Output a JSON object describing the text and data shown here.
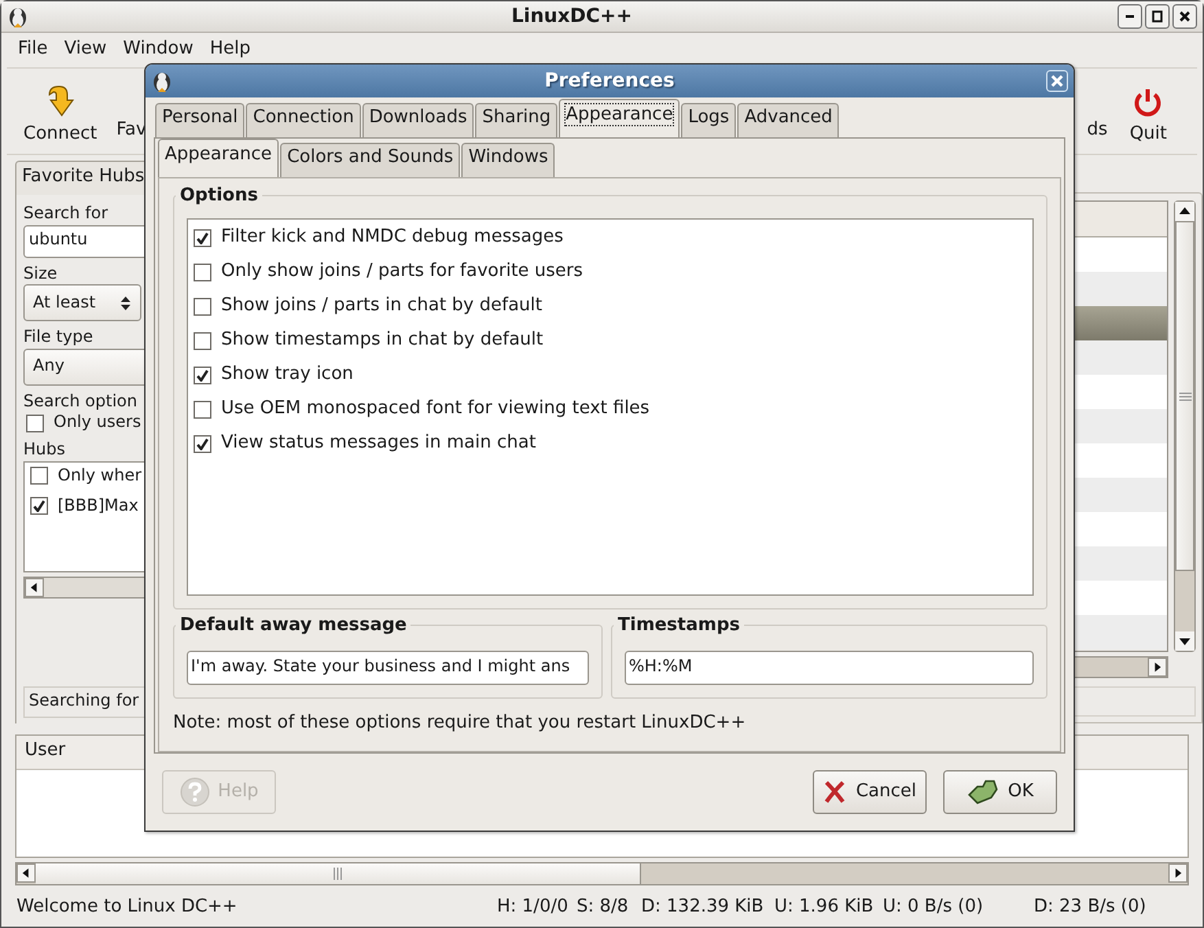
{
  "window": {
    "title": "LinuxDC++"
  },
  "menu": [
    "File",
    "View",
    "Window",
    "Help"
  ],
  "toolbar": [
    {
      "label": "Connect",
      "kind": "connect"
    },
    {
      "label": "Fav",
      "kind": "partial"
    },
    {
      "label": "ds",
      "kind": "partial"
    },
    {
      "label": "Quit",
      "kind": "quit"
    }
  ],
  "search_panel": {
    "tab": "Favorite Hubs",
    "search_label": "Search for",
    "search_value": "ubuntu",
    "size_label": "Size",
    "size_value": "At least",
    "file_type_label": "File type",
    "file_type_value": "Any",
    "options_label": "Search option",
    "options": [
      {
        "label": "Only users",
        "checked": false
      }
    ],
    "hubs_label": "Hubs",
    "hubs": [
      {
        "label": "Only wher",
        "checked": false
      },
      {
        "label": "[BBB]Max",
        "checked": true
      }
    ],
    "status": "Searching for"
  },
  "results": {
    "rows": [
      {
        "selected": false
      },
      {
        "selected": false
      },
      {
        "selected": true
      },
      {
        "selected": false
      },
      {
        "selected": false
      },
      {
        "selected": false
      },
      {
        "selected": false
      },
      {
        "selected": false
      },
      {
        "selected": false
      },
      {
        "selected": false
      },
      {
        "selected": false
      },
      {
        "selected": false
      }
    ]
  },
  "users": {
    "columns": [
      "User"
    ]
  },
  "status_bar": [
    "Welcome to Linux DC++",
    "H: 1/0/0",
    "S: 8/8",
    "D: 132.39 KiB",
    "U: 1.96 KiB",
    "U: 0 B/s (0)",
    "D: 23 B/s (0)"
  ],
  "dialog": {
    "title": "Preferences",
    "tabs": [
      {
        "label": "Personal",
        "selected": false
      },
      {
        "label": "Connection",
        "selected": false
      },
      {
        "label": "Downloads",
        "selected": false
      },
      {
        "label": "Sharing",
        "selected": false
      },
      {
        "label": "Appearance",
        "selected": true
      },
      {
        "label": "Logs",
        "selected": false
      },
      {
        "label": "Advanced",
        "selected": false
      }
    ],
    "subtabs": [
      {
        "label": "Appearance",
        "selected": true
      },
      {
        "label": "Colors and Sounds",
        "selected": false
      },
      {
        "label": "Windows",
        "selected": false
      }
    ],
    "options_title": "Options",
    "options": [
      {
        "label": "Filter kick and NMDC debug messages",
        "checked": true
      },
      {
        "label": "Only show joins / parts for favorite users",
        "checked": false
      },
      {
        "label": "Show joins / parts in chat by default",
        "checked": false
      },
      {
        "label": "Show timestamps in chat by default",
        "checked": false
      },
      {
        "label": "Show tray icon",
        "checked": true
      },
      {
        "label": "Use OEM monospaced font for viewing text files",
        "checked": false
      },
      {
        "label": "View status messages in main chat",
        "checked": true
      }
    ],
    "away": {
      "title": "Default away message",
      "value": "I'm away. State your business and I might ans"
    },
    "timestamps": {
      "title": "Timestamps",
      "value": "%H:%M"
    },
    "note": "Note: most of these options require that you restart LinuxDC++",
    "buttons": [
      {
        "label": "Help",
        "kind": "help",
        "disabled": true
      },
      {
        "label": "Cancel",
        "kind": "cancel",
        "disabled": false
      },
      {
        "label": "OK",
        "kind": "ok",
        "disabled": false
      }
    ]
  }
}
